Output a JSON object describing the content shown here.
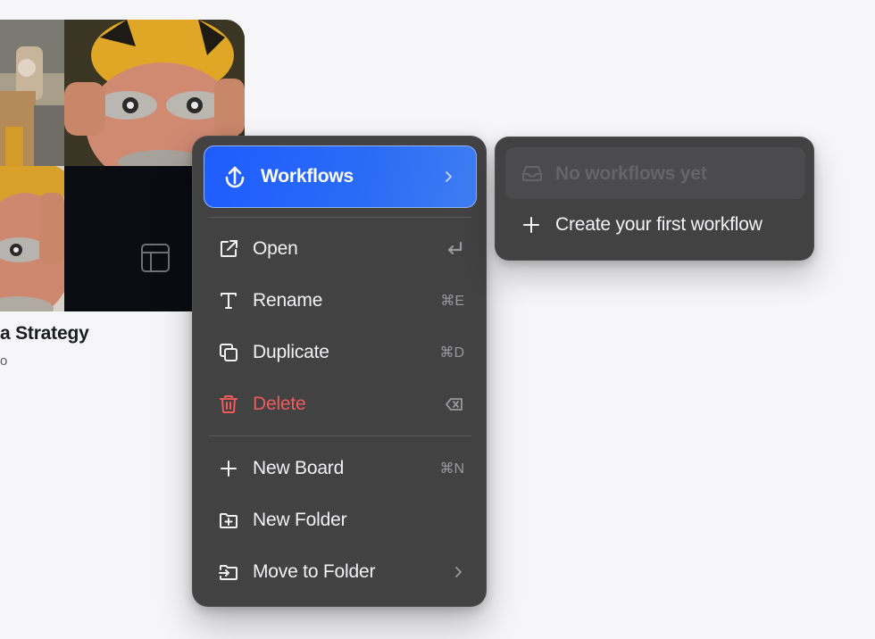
{
  "card": {
    "title": "a Strategy",
    "subtitle": "o"
  },
  "menu": {
    "workflows_item": {
      "label": "Workflows",
      "icon": "workflow-upload-icon"
    },
    "items": [
      {
        "label": "Open",
        "icon": "external-link-icon",
        "shortcut_icon": "return-key-icon"
      },
      {
        "label": "Rename",
        "icon": "text-t-icon",
        "shortcut": "⌘E"
      },
      {
        "label": "Duplicate",
        "icon": "copy-icon",
        "shortcut": "⌘D"
      },
      {
        "label": "Delete",
        "icon": "trash-icon",
        "shortcut_icon": "backspace-key-icon"
      },
      {
        "label": "New Board",
        "icon": "plus-icon",
        "shortcut": "⌘N"
      },
      {
        "label": "New Folder",
        "icon": "folder-plus-icon"
      },
      {
        "label": "Move to Folder",
        "icon": "folder-move-icon"
      }
    ]
  },
  "submenu": {
    "empty_label": "No workflows yet",
    "create_label": "Create your first workflow"
  },
  "colors": {
    "menu_bg": "#424243",
    "accent": "#1f5cff",
    "danger": "#ef5b5b",
    "page_bg": "#f6f6f8"
  }
}
